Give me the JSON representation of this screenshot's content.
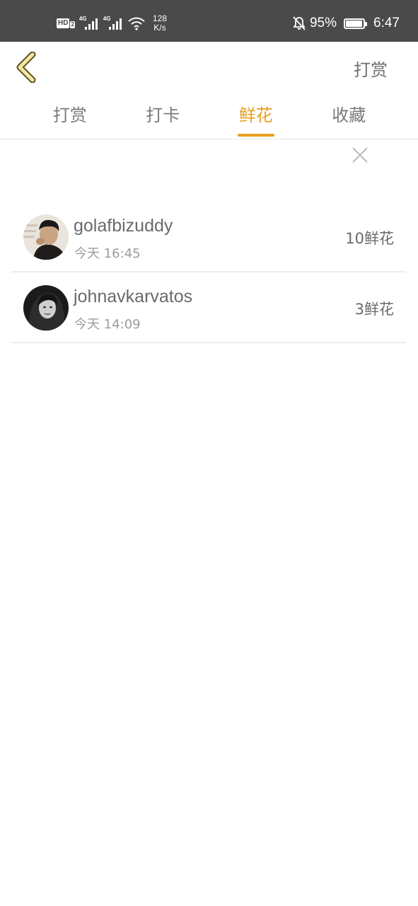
{
  "status_bar": {
    "hd_label": "HD",
    "hd_sub": "2",
    "signal1_label": "4G",
    "signal2_label": "4G",
    "speed_value": "128",
    "speed_unit": "K/s",
    "battery": "95%",
    "battery_level": 0.95,
    "time": "6:47"
  },
  "header": {
    "action_label": "打赏"
  },
  "tabs": [
    {
      "label": "打赏",
      "active": false
    },
    {
      "label": "打卡",
      "active": false
    },
    {
      "label": "鲜花",
      "active": true
    },
    {
      "label": "收藏",
      "active": false
    }
  ],
  "colors": {
    "accent": "#e7a01e",
    "status_bar": "#4a4a4a"
  },
  "list": [
    {
      "username": "golafbizuddy",
      "time": "今天 16:45",
      "count": "10鲜花"
    },
    {
      "username": "johnavkarvatos",
      "time": "今天 14:09",
      "count": "3鲜花"
    }
  ]
}
